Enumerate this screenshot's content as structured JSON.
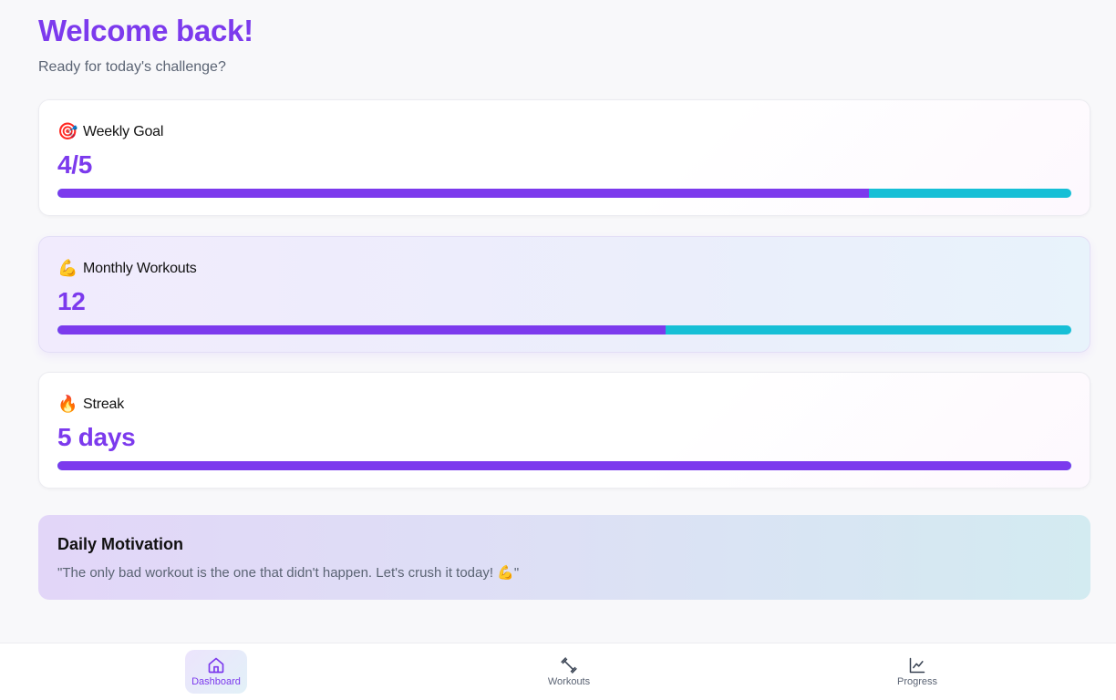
{
  "header": {
    "title": "Welcome back!",
    "subtitle": "Ready for today's challenge?"
  },
  "cards": [
    {
      "emoji": "🎯",
      "label": "Weekly Goal",
      "value": "4/5",
      "progress": 0.8
    },
    {
      "emoji": "💪",
      "label": "Monthly Workouts",
      "value": "12",
      "progress": 0.6
    },
    {
      "emoji": "🔥",
      "label": "Streak",
      "value": "5 days",
      "progress": 1.0
    }
  ],
  "motivation": {
    "title": "Daily Motivation",
    "quote": "\"The only bad workout is the one that didn't happen. Let's crush it today! 💪\""
  },
  "nav": {
    "items": [
      {
        "label": "Dashboard",
        "icon": "home-icon",
        "active": true
      },
      {
        "label": "Workouts",
        "icon": "dumbbell-icon",
        "active": false
      },
      {
        "label": "Progress",
        "icon": "chart-line-icon",
        "active": false
      }
    ]
  },
  "colors": {
    "accent": "#7c3aed",
    "progress_track": "#16bfd6",
    "muted_text": "#5b6474"
  }
}
